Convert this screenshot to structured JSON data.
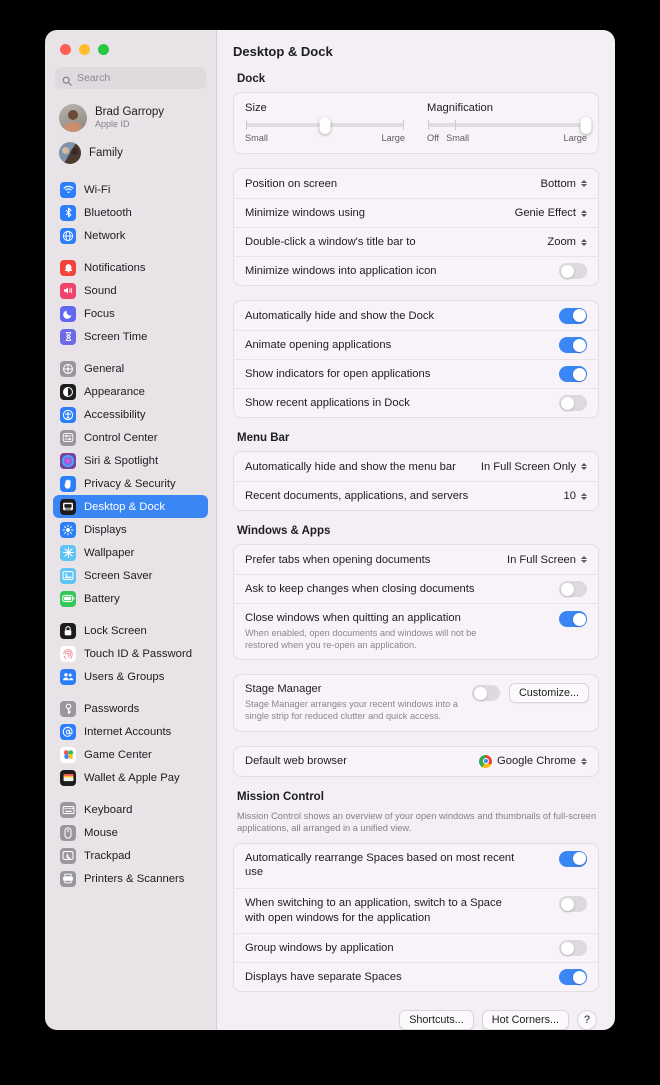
{
  "window": {
    "title": "Desktop & Dock"
  },
  "sidebar": {
    "search_placeholder": "Search",
    "account": {
      "name": "Brad Garropy",
      "subtitle": "Apple ID"
    },
    "family": {
      "label": "Family"
    },
    "groups": [
      {
        "items": [
          {
            "label": "Wi-Fi",
            "icon": "wifi-icon",
            "color": "#2d7ff9"
          },
          {
            "label": "Bluetooth",
            "icon": "bluetooth-icon",
            "color": "#2d7ff9"
          },
          {
            "label": "Network",
            "icon": "network-globe-icon",
            "color": "#2d7ff9"
          }
        ]
      },
      {
        "items": [
          {
            "label": "Notifications",
            "icon": "bell-icon",
            "color": "#f04438"
          },
          {
            "label": "Sound",
            "icon": "speaker-icon",
            "color": "#f0436b"
          },
          {
            "label": "Focus",
            "icon": "moon-icon",
            "color": "#6366f1"
          },
          {
            "label": "Screen Time",
            "icon": "hourglass-icon",
            "color": "#6d6ae8"
          }
        ]
      },
      {
        "items": [
          {
            "label": "General",
            "icon": "gear-icon",
            "color": "#9a969f"
          },
          {
            "label": "Appearance",
            "icon": "appearance-icon",
            "color": "#1d1d1f"
          },
          {
            "label": "Accessibility",
            "icon": "accessibility-icon",
            "color": "#2d7ff9"
          },
          {
            "label": "Control Center",
            "icon": "control-center-icon",
            "color": "#9a969f"
          },
          {
            "label": "Siri & Spotlight",
            "icon": "siri-icon",
            "color": "#7b3fa0"
          },
          {
            "label": "Privacy & Security",
            "icon": "privacy-hand-icon",
            "color": "#2d7ff9"
          },
          {
            "label": "Desktop & Dock",
            "icon": "desktop-dock-icon",
            "color": "#1d1d1f",
            "selected": true
          },
          {
            "label": "Displays",
            "icon": "displays-icon",
            "color": "#2d7ff9"
          },
          {
            "label": "Wallpaper",
            "icon": "wallpaper-icon",
            "color": "#5ec3f5"
          },
          {
            "label": "Screen Saver",
            "icon": "screen-saver-icon",
            "color": "#5ec3f5"
          },
          {
            "label": "Battery",
            "icon": "battery-icon",
            "color": "#34c759"
          }
        ]
      },
      {
        "items": [
          {
            "label": "Lock Screen",
            "icon": "lock-icon",
            "color": "#1d1d1f"
          },
          {
            "label": "Touch ID & Password",
            "icon": "fingerprint-icon",
            "color": "#fdfdfd"
          },
          {
            "label": "Users & Groups",
            "icon": "users-icon",
            "color": "#2d7ff9"
          }
        ]
      },
      {
        "items": [
          {
            "label": "Passwords",
            "icon": "key-icon",
            "color": "#9a969f"
          },
          {
            "label": "Internet Accounts",
            "icon": "at-sign-icon",
            "color": "#2d7ff9"
          },
          {
            "label": "Game Center",
            "icon": "game-center-icon",
            "color": "#fdfdfd"
          },
          {
            "label": "Wallet & Apple Pay",
            "icon": "wallet-icon",
            "color": "#1d1d1f"
          }
        ]
      },
      {
        "items": [
          {
            "label": "Keyboard",
            "icon": "keyboard-icon",
            "color": "#9a969f"
          },
          {
            "label": "Mouse",
            "icon": "mouse-icon",
            "color": "#9a969f"
          },
          {
            "label": "Trackpad",
            "icon": "trackpad-icon",
            "color": "#9a969f"
          },
          {
            "label": "Printers & Scanners",
            "icon": "printer-icon",
            "color": "#9a969f"
          }
        ]
      }
    ]
  },
  "main": {
    "dock": {
      "section_title": "Dock",
      "size": {
        "label": "Size",
        "min_label": "Small",
        "max_label": "Large",
        "value_percent": 50
      },
      "magnification": {
        "label": "Magnification",
        "off_label": "Off",
        "small_label": "Small",
        "max_label": "Large",
        "value_percent": 100
      },
      "rows": [
        {
          "label": "Position on screen",
          "value": "Bottom",
          "control": "popup"
        },
        {
          "label": "Minimize windows using",
          "value": "Genie Effect",
          "control": "popup"
        },
        {
          "label": "Double-click a window's title bar to",
          "value": "Zoom",
          "control": "popup"
        },
        {
          "label": "Minimize windows into application icon",
          "control": "toggle",
          "on": false
        }
      ],
      "toggles": [
        {
          "label": "Automatically hide and show the Dock",
          "on": true
        },
        {
          "label": "Animate opening applications",
          "on": true
        },
        {
          "label": "Show indicators for open applications",
          "on": true
        },
        {
          "label": "Show recent applications in Dock",
          "on": false
        }
      ]
    },
    "menu_bar": {
      "section_title": "Menu Bar",
      "rows": [
        {
          "label": "Automatically hide and show the menu bar",
          "value": "In Full Screen Only",
          "control": "popup"
        },
        {
          "label": "Recent documents, applications, and servers",
          "value": "10",
          "control": "popup"
        }
      ]
    },
    "windows_apps": {
      "section_title": "Windows & Apps",
      "rows": [
        {
          "label": "Prefer tabs when opening documents",
          "value": "In Full Screen",
          "control": "popup"
        },
        {
          "label": "Ask to keep changes when closing documents",
          "control": "toggle",
          "on": false
        },
        {
          "label": "Close windows when quitting an application",
          "sub": "When enabled, open documents and windows will not be restored when you re-open an application.",
          "control": "toggle",
          "on": true
        }
      ],
      "stage_manager": {
        "label": "Stage Manager",
        "sub": "Stage Manager arranges your recent windows into a single strip for reduced clutter and quick access.",
        "on": false,
        "button": "Customize..."
      },
      "default_browser": {
        "label": "Default web browser",
        "value": "Google Chrome",
        "icon": "chrome-icon"
      }
    },
    "mission_control": {
      "section_title": "Mission Control",
      "section_desc": "Mission Control shows an overview of your open windows and thumbnails of full-screen applications, all arranged in a unified view.",
      "toggles": [
        {
          "label": "Automatically rearrange Spaces based on most recent use",
          "on": true
        },
        {
          "label": "When switching to an application, switch to a Space with open windows for the application",
          "on": false
        },
        {
          "label": "Group windows by application",
          "on": false
        },
        {
          "label": "Displays have separate Spaces",
          "on": true
        }
      ]
    },
    "footer": {
      "shortcuts": "Shortcuts...",
      "hot_corners": "Hot Corners...",
      "help": "?"
    }
  },
  "colors": {
    "accent": "#3a86f5",
    "window_bg": "#f3eff4",
    "sidebar_bg": "#e7e3e7"
  }
}
